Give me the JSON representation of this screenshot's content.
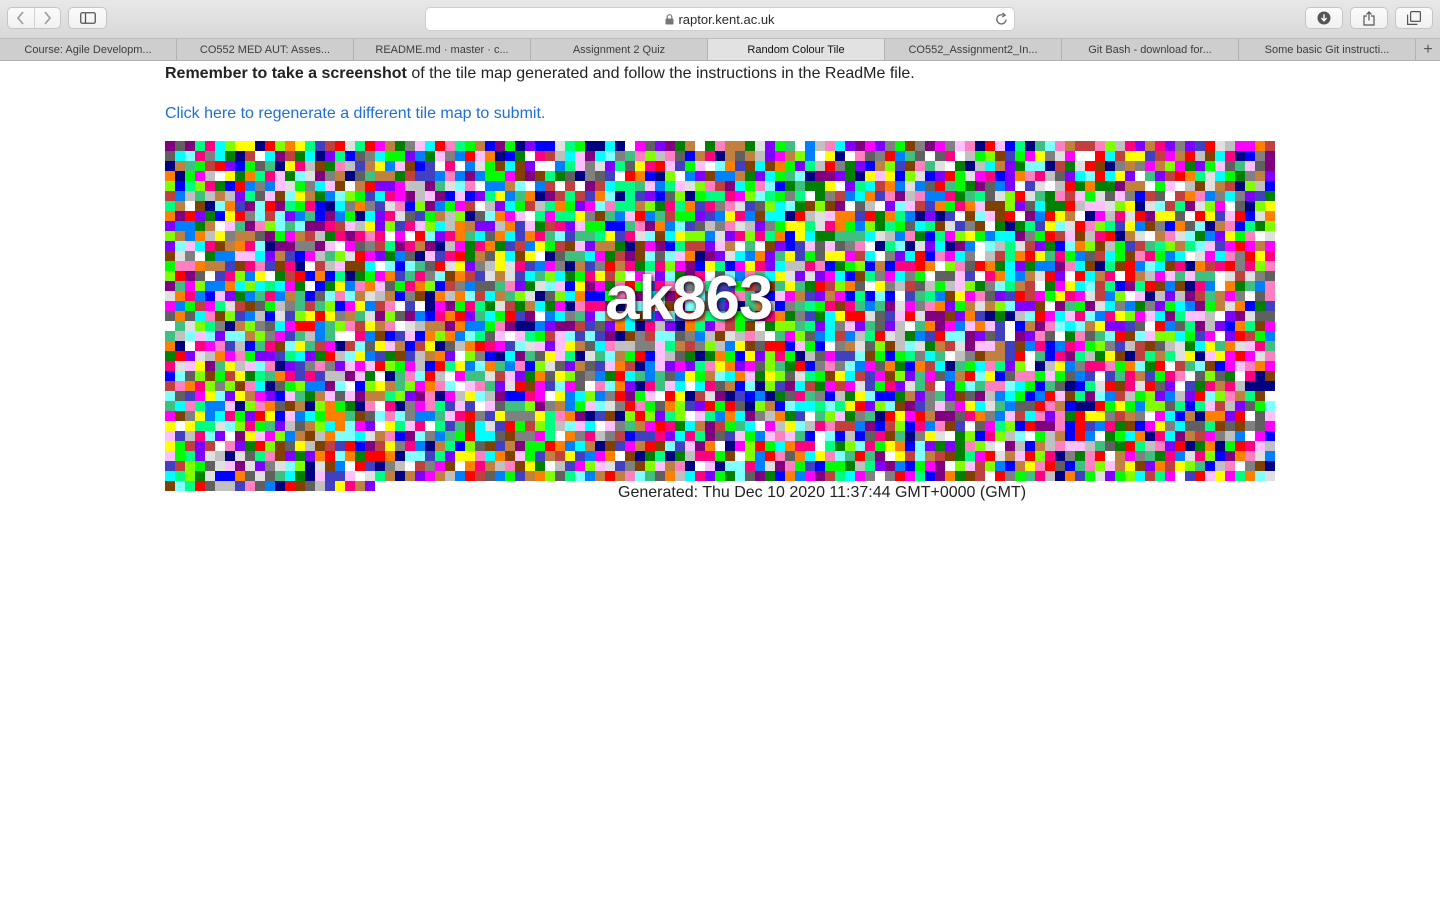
{
  "browser": {
    "url": "raptor.kent.ac.uk",
    "icons": {
      "back": "chevron-left-icon",
      "forward": "chevron-right-icon",
      "sidebar": "sidebar-icon",
      "lock": "lock-icon",
      "reload": "reload-icon",
      "downloads": "download-icon",
      "share": "share-icon",
      "tabs": "tab-overview-icon"
    },
    "tabs": [
      {
        "label": "Course: Agile Developm..."
      },
      {
        "label": "CO552 MED AUT: Asses..."
      },
      {
        "label": "README.md · master · c..."
      },
      {
        "label": "Assignment 2 Quiz"
      },
      {
        "label": "Random Colour Tile",
        "active": true
      },
      {
        "label": "CO552_Assignment2_In..."
      },
      {
        "label": "Git Bash - download for..."
      },
      {
        "label": "Some basic Git instructi..."
      }
    ],
    "new_tab": "+"
  },
  "page": {
    "instruction_bold": "Remember to take a screenshot",
    "instruction_rest": " of the tile map generated and follow the instructions in the ReadMe file.",
    "regenerate_link": "Click here to regenerate a different tile map to submit.",
    "username": "ak863",
    "generated": "Generated: Thu Dec 10 2020 11:37:44 GMT+0000 (GMT)"
  },
  "tilemap": {
    "columns": 111,
    "full_rows": 34,
    "last_row_tiles": 21,
    "palette": [
      "#ff00ff",
      "#00ff00",
      "#ff0000",
      "#0000ff",
      "#00ffff",
      "#ffff00",
      "#ff8000",
      "#8000ff",
      "#00ff80",
      "#ff0080",
      "#80ff00",
      "#0080ff",
      "#008000",
      "#800080",
      "#808080",
      "#c0c0c0",
      "#ffffff",
      "#000080",
      "#ff80c0",
      "#80ffff",
      "#c08040",
      "#40c080",
      "#4040c0",
      "#c04040",
      "#e0e0e0",
      "#606060",
      "#804000",
      "#ffc0ff"
    ]
  }
}
